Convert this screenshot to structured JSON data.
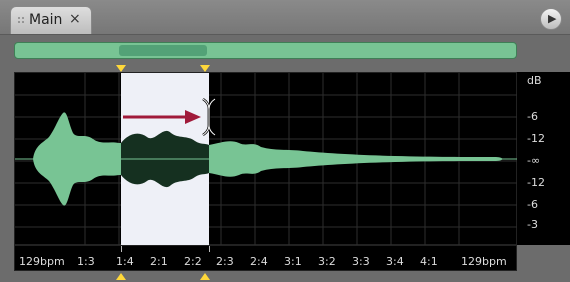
{
  "tab": {
    "label": "Main",
    "close": "×"
  },
  "panel_menu_glyph": "▶",
  "db_scale_labels": [
    "dB",
    "-6",
    "-12",
    "-∞",
    "-12",
    "-6",
    "-3"
  ],
  "timeline_labels": [
    "129bpm",
    "1:3",
    "1:4",
    "2:1",
    "2:2",
    "2:3",
    "2:4",
    "3:1",
    "3:2",
    "3:3",
    "3:4",
    "4:1",
    "129bpm"
  ],
  "colors": {
    "waveform": "#78c494",
    "selection_fill": "#eef0f7",
    "selection_waveform": "#153020",
    "arrow": "#a01a3a",
    "marker": "#ffd83a"
  }
}
